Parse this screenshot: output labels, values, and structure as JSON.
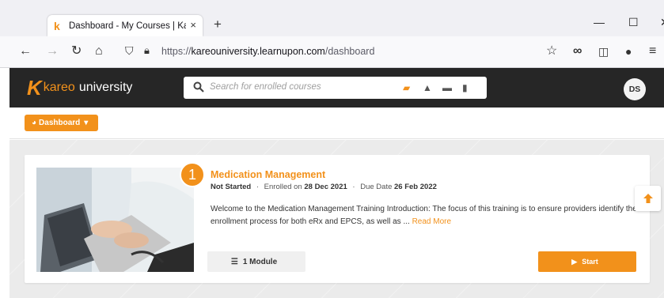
{
  "browser": {
    "tab_title": "Dashboard - My Courses | Kareo",
    "tab_close": "×",
    "new_tab": "+",
    "minimize": "—",
    "maximize": "☐",
    "close": "✕",
    "url_prefix": "https://",
    "url_domain": "kareouniversity.learnupon.com",
    "url_path": "/dashboard"
  },
  "app": {
    "logo_brand": "kareo",
    "logo_suffix": "university",
    "search_placeholder": "Search for enrolled courses",
    "user_initials": "DS",
    "accent_color": "#f2911b"
  },
  "subnav": {
    "dashboard_label": "Dashboard"
  },
  "course": {
    "number": "1",
    "title": "Medication Management",
    "status": "Not Started",
    "enrolled_label": "Enrolled on",
    "enrolled_date": "28 Dec 2021",
    "due_label": "Due Date",
    "due_date": "26 Feb 2022",
    "description": "Welcome to the Medication Management Training Introduction: The focus of this training is to ensure providers identify the enrollment process for both eRx and EPCS, as well as ...",
    "read_more": "Read More",
    "modules_label": "1 Module",
    "start_label": "Start"
  }
}
